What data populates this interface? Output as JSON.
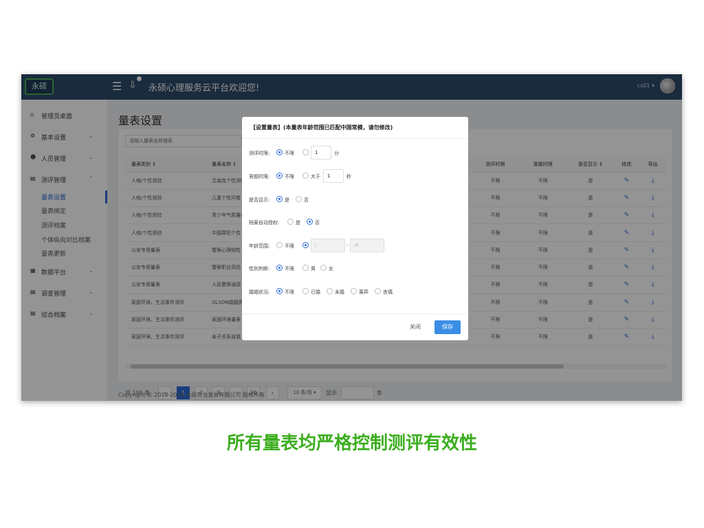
{
  "header": {
    "logo": "永硕",
    "welcome": "永硕心理服务云平台欢迎您!",
    "user": "cs01 ▾"
  },
  "sidebar": {
    "items": [
      {
        "label": "管理员桌面",
        "icon": "home-icon"
      },
      {
        "label": "基本设置",
        "icon": "gear-icon",
        "chev": "⌄"
      },
      {
        "label": "人员管理",
        "icon": "users-icon",
        "chev": "⌄"
      },
      {
        "label": "测评管理",
        "icon": "doc-icon",
        "chev": "⌃"
      }
    ],
    "sub_items": [
      "量表设置",
      "量表绑定",
      "测评档案",
      "个体纵向对比档案",
      "量表更新"
    ],
    "items_after": [
      {
        "label": "数据平台",
        "icon": "grid-icon",
        "chev": "⌄"
      },
      {
        "label": "调查管理",
        "icon": "doc-icon",
        "chev": "⌄"
      },
      {
        "label": "综合档案",
        "icon": "doc-icon",
        "chev": "⌄"
      }
    ]
  },
  "main": {
    "title": "量表设置",
    "search_placeholder": "请输入量表名称搜索",
    "columns": [
      "量表类别 ⇕",
      "量表名称 ⇕",
      "测评时限",
      "答题时限",
      "是否显示 ⇕",
      "修改",
      "导出"
    ],
    "rows": [
      [
        "人格/个性测验",
        "艾森克个性测验",
        "不限",
        "不限",
        "是"
      ],
      [
        "人格/个性测验",
        "儿童个性问卷",
        "不限",
        "不限",
        "是"
      ],
      [
        "人格/个性测验",
        "青少年气质量表",
        "不限",
        "不限",
        "是"
      ],
      [
        "人格/个性测验",
        "中国罪犯个性",
        "不限",
        "不限",
        "是"
      ],
      [
        "公安专用量表",
        "警察心理韧性",
        "不限",
        "不限",
        "是"
      ],
      [
        "公安专用量表",
        "警察职业风险",
        "不限",
        "不限",
        "是"
      ],
      [
        "公安专用量表",
        "人民警察通感",
        "不限",
        "不限",
        "是"
      ],
      [
        "家庭环境、生活事件测评",
        "OLSON婚姻质",
        "不限",
        "不限",
        "是"
      ],
      [
        "家庭环境、生活事件测评",
        "家庭环境量表",
        "不限",
        "不限",
        "是"
      ],
      [
        "家庭环境、生活事件测评",
        "亲子关系自我",
        "不限",
        "不限",
        "是"
      ]
    ],
    "pager": {
      "total": "共 195 条",
      "prev": "‹",
      "pages": [
        "1",
        "2",
        "3",
        "···",
        "20"
      ],
      "next": "›",
      "page_size": "10 条/页 ▾",
      "goto_label": "显示",
      "goto_unit": "条"
    },
    "footer": "Copyright © 2018-2028 永硕实业发展有限公司 版权所有"
  },
  "dialog": {
    "title": "【设置量表】(本量表年龄范围已匹配中国常模，请勿修改)",
    "test_limit": {
      "label": "测评时限:",
      "opt_unlimited": "不限",
      "value": "1",
      "unit": "分"
    },
    "answer_limit": {
      "label": "答题时限:",
      "opt_unlimited": "不限",
      "opt_more": "大于",
      "value": "1",
      "unit": "秒"
    },
    "display": {
      "label": "是否显示:",
      "yes": "是",
      "no": "否"
    },
    "auto_auth": {
      "label": "档案自动授权:",
      "yes": "是",
      "no": "否"
    },
    "age_range": {
      "label": "年龄范围:",
      "opt_unlimited": "不限",
      "from": "/",
      "dash": "-",
      "to": "/6"
    },
    "gender": {
      "label": "性别判断:",
      "opt_unlimited": "不限",
      "male": "男",
      "female": "女"
    },
    "marital": {
      "label": "婚姻状况:",
      "opt_unlimited": "不限",
      "married": "已婚",
      "unmarried": "未婚",
      "divorced": "离异",
      "widowed": "丧偶"
    },
    "close": "关闭",
    "save": "保存"
  },
  "slogan": "所有量表均严格控制测评有效性",
  "colors": {
    "accent": "#2d6bd6",
    "header": "#2d4a6b",
    "slogan": "#3cae1f",
    "save": "#3a8ee6"
  }
}
